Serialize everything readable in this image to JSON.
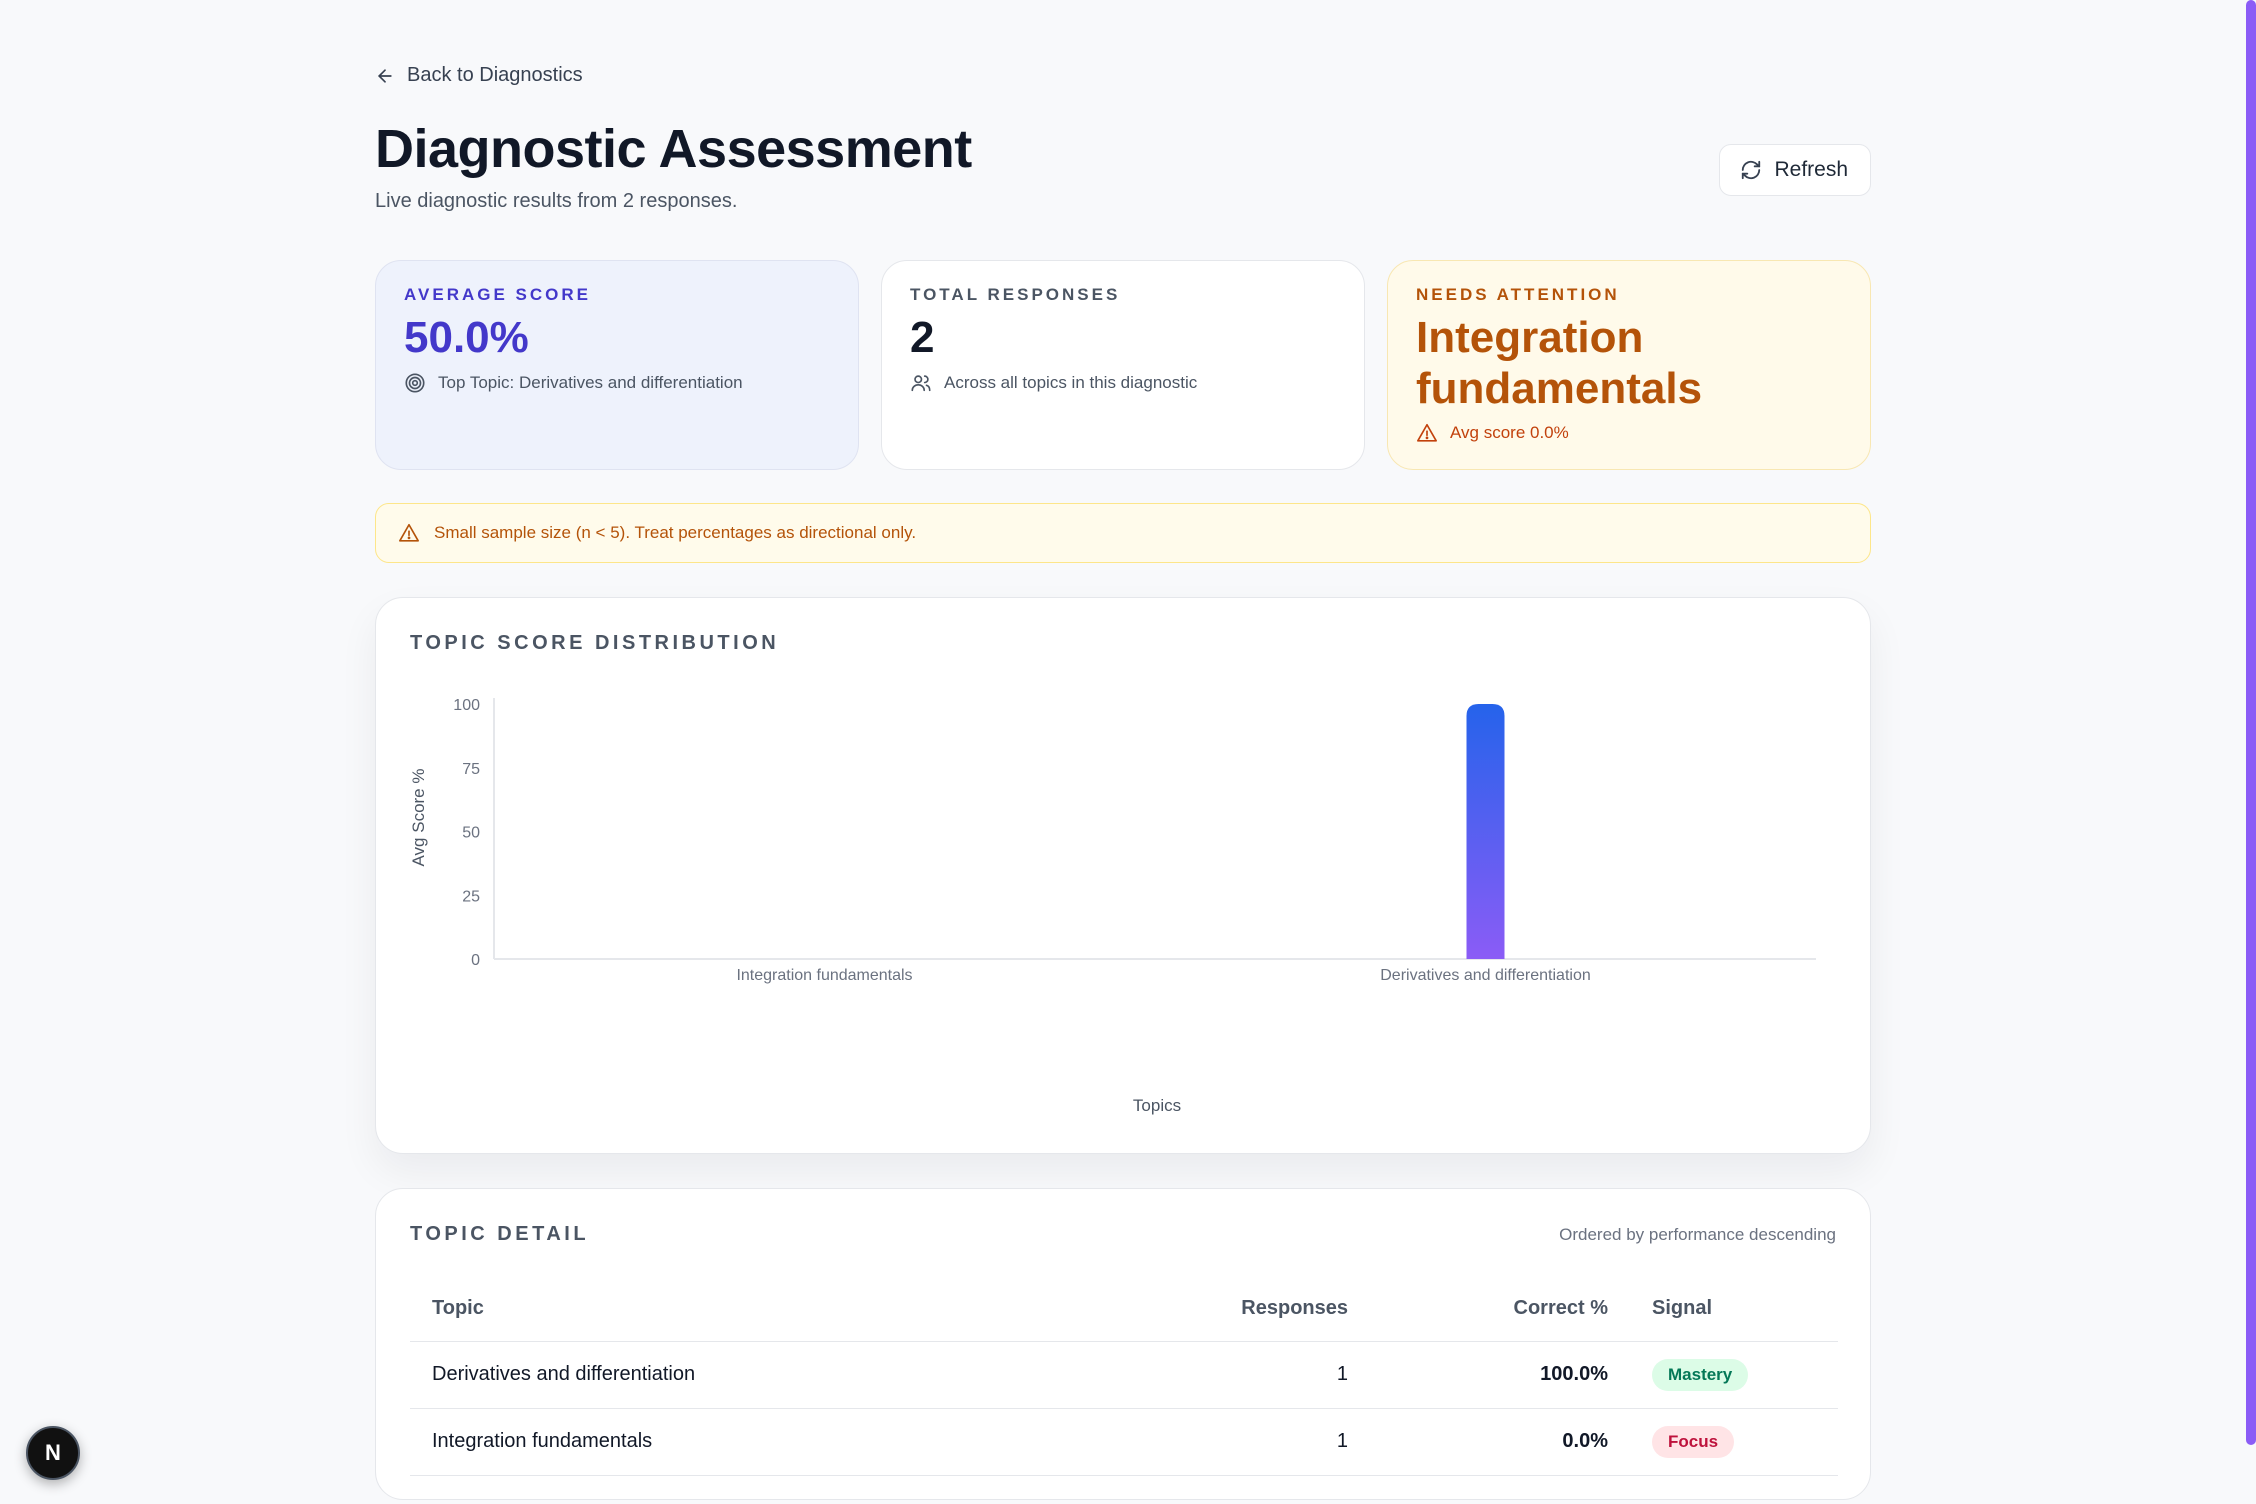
{
  "nav": {
    "back_label": "Back to Diagnostics"
  },
  "header": {
    "title": "Diagnostic Assessment",
    "subtitle": "Live diagnostic results from 2 responses.",
    "refresh_label": "Refresh"
  },
  "stats": [
    {
      "label": "AVERAGE SCORE",
      "value": "50.0%",
      "note": "Top Topic: Derivatives and differentiation",
      "icon": "target-icon"
    },
    {
      "label": "TOTAL RESPONSES",
      "value": "2",
      "note": "Across all topics in this diagnostic",
      "icon": "users-icon"
    },
    {
      "label": "NEEDS ATTENTION",
      "value": "Integration fundamentals",
      "note": "Avg score 0.0%",
      "icon": "warning-icon"
    }
  ],
  "warning": {
    "text": "Small sample size (n < 5). Treat percentages as directional only."
  },
  "chart_panel": {
    "title": "TOPIC SCORE DISTRIBUTION"
  },
  "chart_data": {
    "type": "bar",
    "categories": [
      "Integration fundamentals",
      "Derivatives and differentiation"
    ],
    "values": [
      0,
      100
    ],
    "xlabel": "Topics",
    "ylabel": "Avg Score %",
    "ylim": [
      0,
      100
    ],
    "yticks": [
      "0",
      "25",
      "50",
      "75",
      "100"
    ],
    "grid": false,
    "bar_gradient": [
      "#2563eb",
      "#8b5cf6"
    ]
  },
  "table_panel": {
    "title": "TOPIC DETAIL",
    "note": "Ordered by performance descending",
    "columns": [
      "Topic",
      "Responses",
      "Correct %",
      "Signal"
    ],
    "rows": [
      {
        "topic": "Derivatives and differentiation",
        "responses": "1",
        "correct": "100.0%",
        "signal": "Mastery"
      },
      {
        "topic": "Integration fundamentals",
        "responses": "1",
        "correct": "0.0%",
        "signal": "Focus"
      }
    ]
  },
  "dev_button": {
    "label": "N"
  }
}
